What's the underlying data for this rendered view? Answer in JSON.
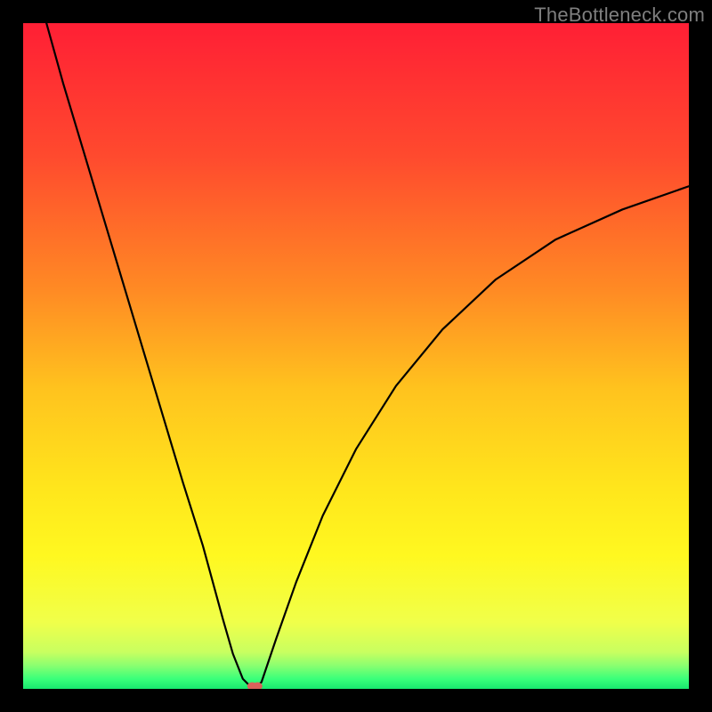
{
  "watermark": "TheBottleneck.com",
  "chart_data": {
    "type": "line",
    "title": "",
    "xlabel": "",
    "ylabel": "",
    "xlim": [
      0,
      100
    ],
    "ylim": [
      0,
      100
    ],
    "gradient_stops": [
      {
        "offset": 0.0,
        "color": "#ff1f35"
      },
      {
        "offset": 0.2,
        "color": "#ff4a2e"
      },
      {
        "offset": 0.4,
        "color": "#ff8a24"
      },
      {
        "offset": 0.55,
        "color": "#ffc31e"
      },
      {
        "offset": 0.7,
        "color": "#ffe61c"
      },
      {
        "offset": 0.8,
        "color": "#fff820"
      },
      {
        "offset": 0.9,
        "color": "#f0ff4a"
      },
      {
        "offset": 0.945,
        "color": "#c8ff60"
      },
      {
        "offset": 0.965,
        "color": "#8aff70"
      },
      {
        "offset": 0.985,
        "color": "#3aff7a"
      },
      {
        "offset": 1.0,
        "color": "#18e86f"
      }
    ],
    "series": [
      {
        "name": "bottleneck-curve",
        "x": [
          3.5,
          6,
          9,
          12,
          15,
          18,
          21,
          24,
          27,
          30,
          31.5,
          33,
          34,
          34.9,
          35.8,
          38,
          41,
          45,
          50,
          56,
          63,
          71,
          80,
          90,
          100
        ],
        "y": [
          100,
          91,
          81,
          71,
          61,
          51,
          41,
          31,
          21.5,
          10.5,
          5.3,
          1.5,
          0.5,
          0.25,
          1.0,
          7.5,
          16,
          26,
          36,
          45.5,
          54,
          61.5,
          67.5,
          72,
          75.5
        ]
      }
    ],
    "markers": [
      {
        "name": "min-point-a",
        "x": 34.4,
        "y": 0.4,
        "color": "#d9625b"
      },
      {
        "name": "min-point-b",
        "x": 35.2,
        "y": 0.4,
        "color": "#d9625b"
      }
    ]
  }
}
